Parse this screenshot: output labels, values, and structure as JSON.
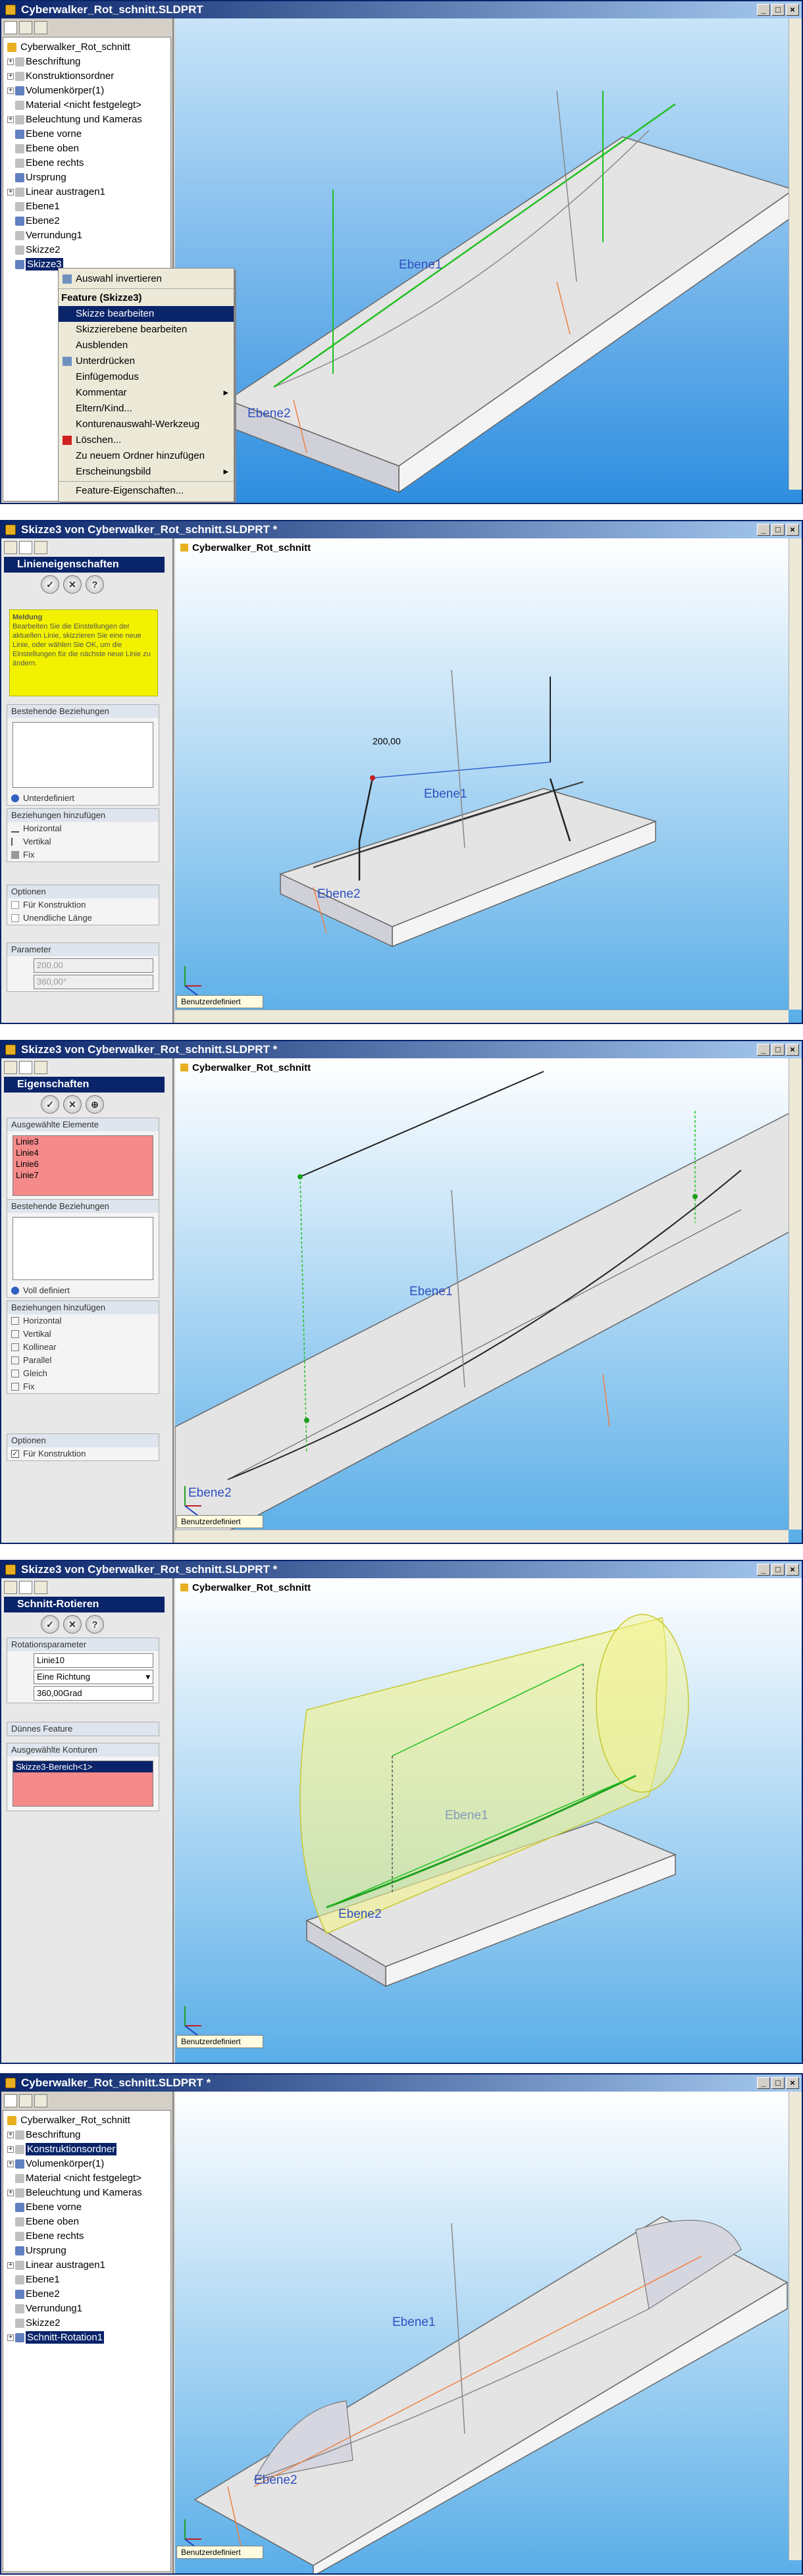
{
  "panels": [
    {
      "title": "Cyberwalker_Rot_schnitt.SLDPRT",
      "tree": [
        {
          "label": "Cyberwalker_Rot_schnitt",
          "root": true
        },
        {
          "label": "Beschriftung",
          "exp": "+"
        },
        {
          "label": "Konstruktionsordner",
          "exp": "+"
        },
        {
          "label": "Volumenkörper(1)",
          "exp": "+"
        },
        {
          "label": "Material <nicht festgelegt>"
        },
        {
          "label": "Beleuchtung und Kameras",
          "exp": "+"
        },
        {
          "label": "Ebene vorne"
        },
        {
          "label": "Ebene oben"
        },
        {
          "label": "Ebene rechts"
        },
        {
          "label": "Ursprung"
        },
        {
          "label": "Linear austragen1",
          "exp": "+"
        },
        {
          "label": "Ebene1"
        },
        {
          "label": "Ebene2"
        },
        {
          "label": "Verrundung1"
        },
        {
          "label": "Skizze2"
        },
        {
          "label": "Skizze3",
          "sel": true
        }
      ],
      "context_menu": {
        "items": [
          {
            "label": "Auswahl invertieren",
            "icon": "invert-icon"
          },
          {
            "label": "Feature (Skizze3)",
            "head": true
          },
          {
            "label": "Skizze bearbeiten",
            "sel": true
          },
          {
            "label": "Skizzierebene bearbeiten"
          },
          {
            "label": "Ausblenden"
          },
          {
            "label": "Unterdrücken",
            "icon": "suppress-icon"
          },
          {
            "label": "Einfügemodus"
          },
          {
            "label": "Kommentar",
            "submenu": true
          },
          {
            "label": "Eltern/Kind..."
          },
          {
            "label": "Konturenauswahl-Werkzeug"
          },
          {
            "label": "Löschen...",
            "icon": "delete-icon"
          },
          {
            "label": "Zu neuem Ordner hinzufügen"
          },
          {
            "label": "Erscheinungsbild",
            "submenu": true
          },
          {
            "label": "Feature-Eigenschaften..."
          }
        ]
      },
      "plane_labels": [
        "Ebene1",
        "Ebene2"
      ]
    },
    {
      "title": "Skizze3 von Cyberwalker_Rot_schnitt.SLDPRT *",
      "viewport_title": "Cyberwalker_Rot_schnitt",
      "pm_title": "Linieneigenschaften",
      "message_title": "Meldung",
      "message": "Bearbeiten Sie die Einstellungen der aktuellen Linie, skizzieren Sie eine neue Linie, oder wählen Sie OK, um die Einstellungen für die nächste neue Linie zu ändern.",
      "groups": {
        "existing": "Bestehende Beziehungen",
        "status": "Unterdefiniert",
        "add": "Beziehungen hinzufügen",
        "add_items": [
          "Horizontal",
          "Vertikal",
          "Fix"
        ],
        "options": "Optionen",
        "option_items": [
          "Für Konstruktion",
          "Unendliche Länge"
        ],
        "params": "Parameter",
        "param_values": [
          "200,00",
          "360,00°"
        ]
      },
      "dimension": "200,00",
      "plane_labels": [
        "Ebene1",
        "Ebene2"
      ],
      "view_mode": "Benutzerdefiniert"
    },
    {
      "title": "Skizze3 von Cyberwalker_Rot_schnitt.SLDPRT *",
      "viewport_title": "Cyberwalker_Rot_schnitt",
      "pm_title": "Eigenschaften",
      "groups": {
        "selected": "Ausgewählte Elemente",
        "selected_items": [
          "Linie3",
          "Linie4",
          "Linie6",
          "Linie7"
        ],
        "existing": "Bestehende Beziehungen",
        "status": "Voll definiert",
        "add": "Beziehungen hinzufügen",
        "add_items": [
          "Horizontal",
          "Vertikal",
          "Kollinear",
          "Parallel",
          "Gleich",
          "Fix"
        ],
        "options": "Optionen",
        "option_items": [
          "Für Konstruktion"
        ]
      },
      "plane_labels": [
        "Ebene1",
        "Ebene2"
      ],
      "view_mode": "Benutzerdefiniert"
    },
    {
      "title": "Skizze3 von Cyberwalker_Rot_schnitt.SLDPRT *",
      "viewport_title": "Cyberwalker_Rot_schnitt",
      "pm_title": "Schnitt-Rotieren",
      "groups": {
        "rotation": "Rotationsparameter",
        "axis": "Linie10",
        "direction": "Eine Richtung",
        "angle": "360,00Grad",
        "thin": "Dünnes Feature",
        "contours": "Ausgewählte Konturen",
        "contour_items": [
          "Skizze3-Bereich<1>"
        ]
      },
      "plane_labels": [
        "Ebene1",
        "Ebene2"
      ],
      "view_mode": "Benutzerdefiniert"
    },
    {
      "title": "Cyberwalker_Rot_schnitt.SLDPRT *",
      "tree": [
        {
          "label": "Cyberwalker_Rot_schnitt",
          "root": true
        },
        {
          "label": "Beschriftung",
          "exp": "+"
        },
        {
          "label": "Konstruktionsordner",
          "exp": "+",
          "sel": true
        },
        {
          "label": "Volumenkörper(1)",
          "exp": "+"
        },
        {
          "label": "Material <nicht festgelegt>"
        },
        {
          "label": "Beleuchtung und Kameras",
          "exp": "+"
        },
        {
          "label": "Ebene vorne"
        },
        {
          "label": "Ebene oben"
        },
        {
          "label": "Ebene rechts"
        },
        {
          "label": "Ursprung"
        },
        {
          "label": "Linear austragen1",
          "exp": "+"
        },
        {
          "label": "Ebene1"
        },
        {
          "label": "Ebene2"
        },
        {
          "label": "Verrundung1"
        },
        {
          "label": "Skizze2"
        },
        {
          "label": "Schnitt-Rotation1",
          "exp": "+",
          "sel": true
        }
      ],
      "plane_labels": [
        "Ebene1",
        "Ebene2"
      ],
      "view_mode": "Benutzerdefiniert"
    }
  ],
  "colors": {
    "titlebar": "#0a246a",
    "viewport_top": "#c8e4f8",
    "viewport_bottom": "#2e8ee0",
    "message_bg": "#f2f200",
    "selected_list_bg": "#f58a8a",
    "revolve_fill": "#f4f48c"
  }
}
